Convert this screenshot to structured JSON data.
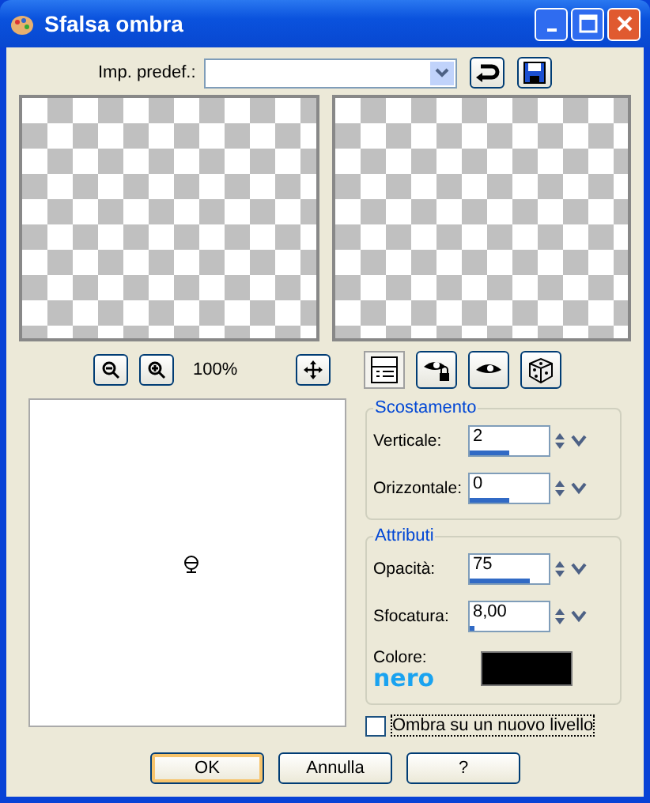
{
  "window": {
    "title": "Sfalsa ombra"
  },
  "preset": {
    "label": "Imp. predef.:"
  },
  "zoom_label": "100%",
  "toolbar": [
    {
      "kind": "proof",
      "selected": true
    },
    {
      "kind": "lock-eye",
      "selected": false
    },
    {
      "kind": "eye",
      "selected": false
    },
    {
      "kind": "dice",
      "selected": false
    }
  ],
  "offset": {
    "title": "Scostamento",
    "fields": [
      {
        "label": "Verticale:",
        "value": "2",
        "level": 0.5
      },
      {
        "label": "Orizzontale:",
        "value": "0",
        "level": 0.5
      }
    ]
  },
  "attributes": {
    "title": "Attributi",
    "fields": [
      {
        "label": "Opacità:",
        "value": "75",
        "level": 0.75
      },
      {
        "label": "Sfocatura:",
        "value": "8,00",
        "level": 0.05
      }
    ],
    "color_label": "Colore:",
    "color": "#000000",
    "annotation": "nero"
  },
  "new_layer": {
    "label": "Ombra su un nuovo livello",
    "checked": false
  },
  "buttons": [
    {
      "label": "OK",
      "default": true
    },
    {
      "label": "Annulla",
      "default": false
    },
    {
      "label": "?",
      "default": false
    }
  ]
}
